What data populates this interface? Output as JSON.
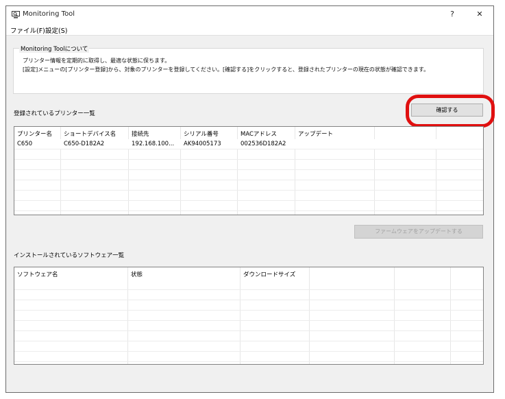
{
  "window": {
    "title": "Monitoring Tool",
    "help_label": "?",
    "close_label": "✕"
  },
  "menu": {
    "file": "ファイル(F)",
    "settings": "設定(S)"
  },
  "about": {
    "legend": "Monitoring Toolについて",
    "line1": "プリンター情報を定期的に取得し、最適な状態に保ちます。",
    "line2": "[設定]メニューの[プリンター登録]から、対象のプリンターを登録してください。[確認する]をクリックすると、登録されたプリンターの現在の状態が確認できます。"
  },
  "printers": {
    "section_label": "登録されているプリンター一覧",
    "confirm_button": "確認する",
    "columns": [
      "プリンター名",
      "ショートデバイス名",
      "接続先",
      "シリアル番号",
      "MACアドレス",
      "アップデート"
    ],
    "rows": [
      [
        "C650",
        "C650-D182A2",
        "192.168.100...",
        "AK94005173",
        "002536D182A2",
        ""
      ]
    ],
    "update_firmware_button": "ファームウェアをアップデートする"
  },
  "software": {
    "section_label": "インストールされているソフトウェア一覧",
    "columns": [
      "ソフトウェア名",
      "状態",
      "ダウンロードサイズ"
    ]
  },
  "colors": {
    "highlight": "#e01010"
  }
}
